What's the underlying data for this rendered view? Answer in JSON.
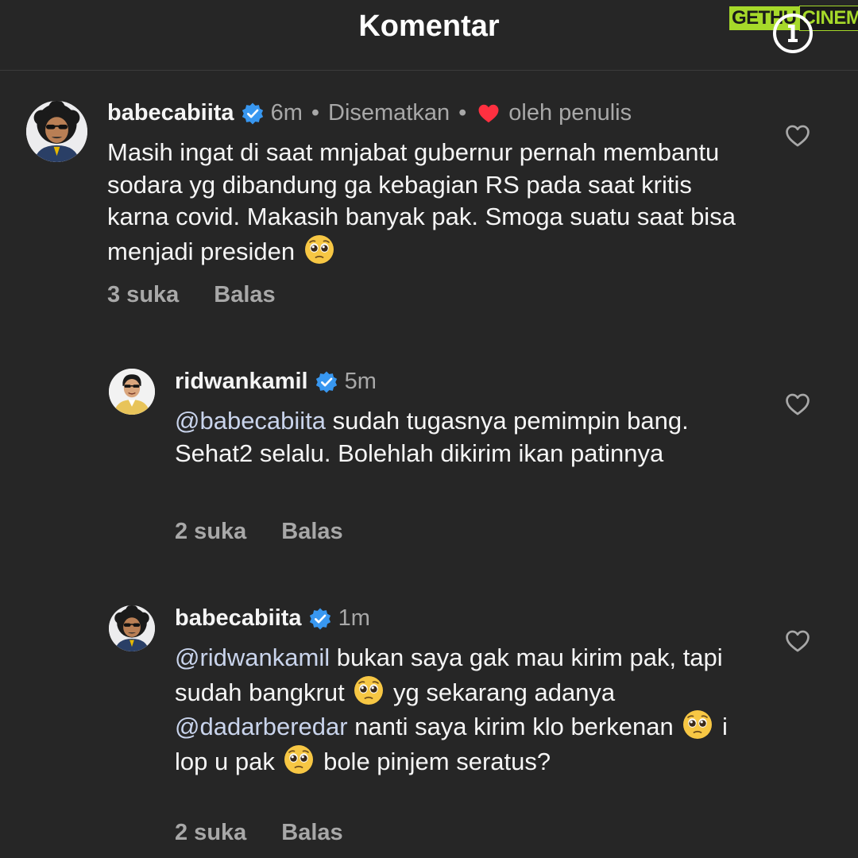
{
  "header": {
    "title": "Komentar"
  },
  "watermark": {
    "part1": "GETHU",
    "part2": "CINEMA"
  },
  "comments": [
    {
      "username": "babecabiita",
      "time": "6m",
      "pinned": "Disematkan",
      "liked_by": "oleh penulis",
      "text": "Masih ingat di saat mnjabat gubernur pernah membantu sodara yg dibandung ga kebagian RS pada saat kritis karna covid. Makasih banyak pak. Smoga suatu saat bisa menjadi presiden",
      "likes": "3 suka",
      "reply": "Balas"
    },
    {
      "username": "ridwankamil",
      "time": "5m",
      "mention": "@babecabiita",
      "text": "sudah tugasnya pemimpin bang. Sehat2 selalu. Bolehlah dikirim ikan patinnya",
      "likes": "2 suka",
      "reply": "Balas"
    },
    {
      "username": "babecabiita",
      "time": "1m",
      "mention": "@ridwankamil",
      "text_a": "bukan saya gak mau kirim pak, tapi sudah bangkrut",
      "text_b": "yg sekarang adanya",
      "mention2": "@dadarberedar",
      "text_c": "nanti saya kirim klo berkenan",
      "text_d": "i lop u pak",
      "text_e": "bole pinjem seratus?",
      "likes": "2 suka",
      "reply": "Balas"
    }
  ],
  "icons": {
    "verified": "verified-badge-icon",
    "heart": "heart-icon",
    "like": "like-outline-icon",
    "emoji": "pleading-face-emoji",
    "info": "info-icon"
  },
  "colors": {
    "background": "#262626",
    "verified": "#3897f0",
    "heart": "#ff3040",
    "secondary_text": "#a8a8a8"
  }
}
